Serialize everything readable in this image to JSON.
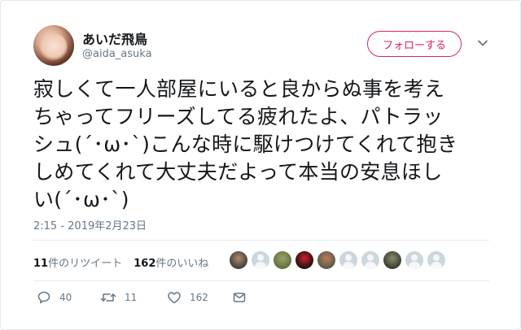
{
  "author": {
    "display_name": "あいだ飛鳥",
    "handle": "@aida_asuka",
    "avatar": "profile-photo"
  },
  "follow_button": {
    "label": "フォローする"
  },
  "menu": {
    "icon": "chevron-down-icon"
  },
  "tweet": {
    "text": "寂しくて一人部屋にいると良からぬ事を考え\nちゃってフリーズしてる疲れたよ、パトラッ\nシュ(´･ω･`)こんな時に駆けつけてくれて抱き\nしめてくれて大丈夫だよって本当の安息ほし\nい(´･ω･`)",
    "timestamp": "2:15 - 2019年2月23日"
  },
  "stats": {
    "retweets_count": "11",
    "retweets_label": "件のリツイート",
    "likes_count": "162",
    "likes_label": "件のいいね"
  },
  "likers": [
    {
      "kind": "photo",
      "colors": [
        "#3a3a3a",
        "#b08a6e"
      ]
    },
    {
      "kind": "default"
    },
    {
      "kind": "photo",
      "colors": [
        "#5d6e3a",
        "#9aa46a"
      ]
    },
    {
      "kind": "photo",
      "colors": [
        "#111111",
        "#d0202a"
      ]
    },
    {
      "kind": "photo",
      "colors": [
        "#4d5a4a",
        "#c0795a"
      ]
    },
    {
      "kind": "default"
    },
    {
      "kind": "default"
    },
    {
      "kind": "photo",
      "colors": [
        "#2f3a2c",
        "#8d8a6a"
      ]
    },
    {
      "kind": "default"
    },
    {
      "kind": "default"
    }
  ],
  "actions": {
    "reply_count": "40",
    "retweet_count": "11",
    "like_count": "162"
  },
  "colors": {
    "accent": "#e0245e",
    "secondary_text": "#657786",
    "divider": "#e6ecf0"
  }
}
